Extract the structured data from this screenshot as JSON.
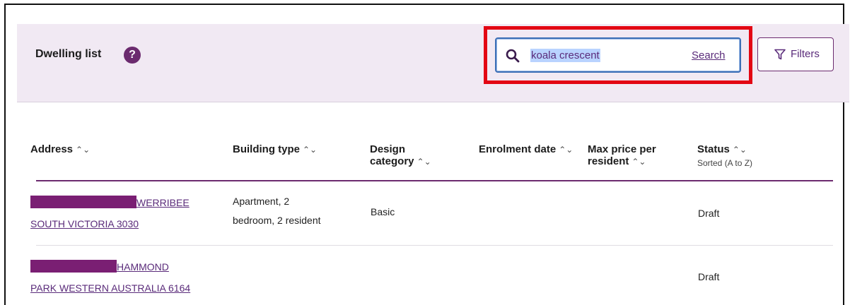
{
  "header": {
    "title": "Dwelling list",
    "help": "?",
    "search_value": "koala crescent",
    "search_link": "Search",
    "filters_label": "Filters"
  },
  "table": {
    "columns": [
      {
        "label": "Address",
        "sort": "⌃⌄"
      },
      {
        "label": "Building type",
        "sort": "⌃⌄"
      },
      {
        "label": "Design",
        "label2": "category",
        "sort": "⌃⌄"
      },
      {
        "label": "Enrolment date",
        "sort": "⌃⌄"
      },
      {
        "label": "Max price per",
        "label2": "resident",
        "sort": "⌃⌄"
      },
      {
        "label": "Status",
        "sort": "⌃⌄",
        "sub": "Sorted (A to Z)"
      }
    ],
    "rows": [
      {
        "address_line1": "WERRIBEE",
        "address_line2": "SOUTH VICTORIA 3030",
        "building_line1": "Apartment, 2",
        "building_line2": "bedroom, 2 resident",
        "design": "Basic",
        "enrolment": "",
        "max_price": "",
        "status": "Draft"
      },
      {
        "address_line1": "HAMMOND",
        "address_line2": "PARK WESTERN AUSTRALIA 6164",
        "building_line1": "",
        "building_line2": "",
        "design": "",
        "enrolment": "",
        "max_price": "",
        "status": "Draft"
      }
    ]
  },
  "colors": {
    "brand_purple": "#6b2a6e",
    "header_bg": "#f1e9f3",
    "highlight_red": "#e30613",
    "redaction": "#7a1f73"
  }
}
